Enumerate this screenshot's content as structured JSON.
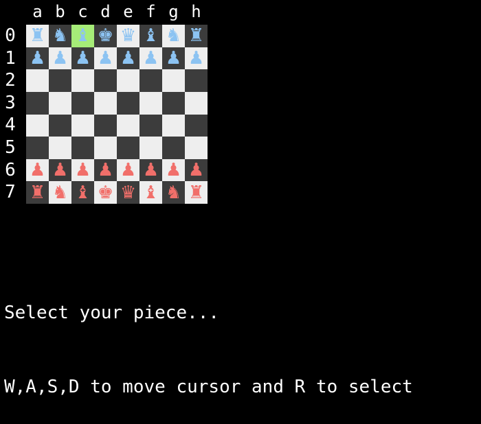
{
  "files": [
    "a",
    "b",
    "c",
    "d",
    "e",
    "f",
    "g",
    "h"
  ],
  "ranks": [
    "0",
    "1",
    "2",
    "3",
    "4",
    "5",
    "6",
    "7"
  ],
  "colors": {
    "background": "#000000",
    "light_square": "#eeeeee",
    "dark_square": "#3c3c3c",
    "cursor_square": "#a6ec78",
    "blue_piece": "#8cc3f2",
    "red_piece": "#f16f6a"
  },
  "cursor": {
    "file": "c",
    "rank": "0"
  },
  "board": [
    [
      "♜",
      "♞",
      "♝",
      "♚",
      "♛",
      "♝",
      "♞",
      "♜"
    ],
    [
      "♟",
      "♟",
      "♟",
      "♟",
      "♟",
      "♟",
      "♟",
      "♟"
    ],
    [
      "",
      "",
      "",
      "",
      "",
      "",
      "",
      ""
    ],
    [
      "",
      "",
      "",
      "",
      "",
      "",
      "",
      ""
    ],
    [
      "",
      "",
      "",
      "",
      "",
      "",
      "",
      ""
    ],
    [
      "",
      "",
      "",
      "",
      "",
      "",
      "",
      ""
    ],
    [
      "♟",
      "♟",
      "♟",
      "♟",
      "♟",
      "♟",
      "♟",
      "♟"
    ],
    [
      "♜",
      "♞",
      "♝",
      "♚",
      "♛",
      "♝",
      "♞",
      "♜"
    ]
  ],
  "piece_sides": [
    "blue",
    "blue",
    "",
    "",
    "",
    "",
    "red",
    "red"
  ],
  "messages": {
    "prompt": "Select your piece...",
    "instructions": "W,A,S,D to move cursor and R to select"
  }
}
